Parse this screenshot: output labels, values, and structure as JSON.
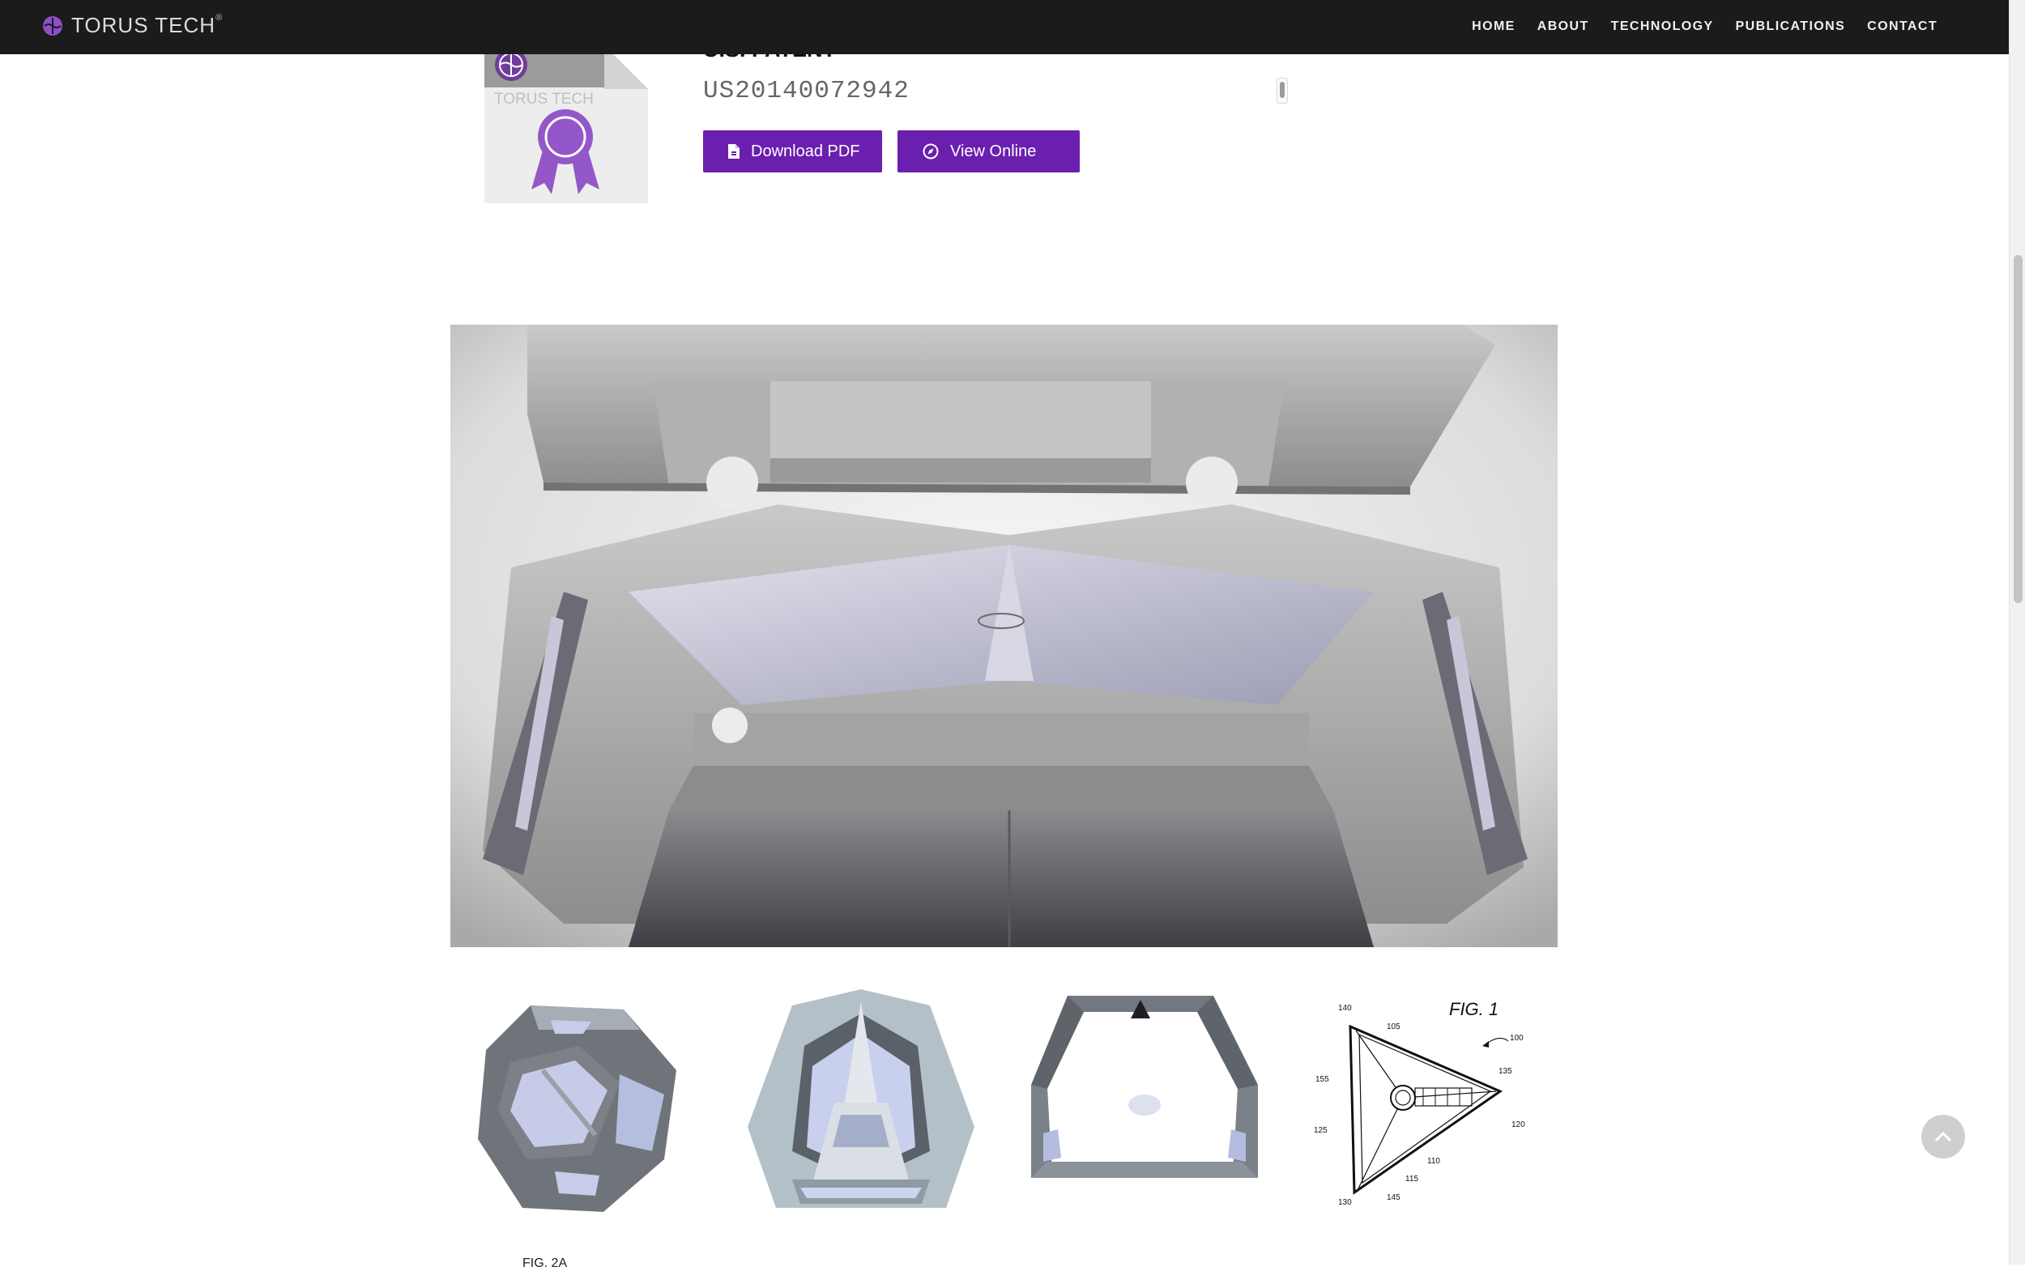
{
  "header": {
    "brand": "TORUS TECH",
    "brand_tm": "®",
    "nav": [
      "HOME",
      "ABOUT",
      "TECHNOLOGY",
      "PUBLICATIONS",
      "CONTACT"
    ]
  },
  "patent": {
    "label": "U.S. PATENT",
    "number": "US20140072942",
    "icon_text": "TORUS TECH",
    "download_label": "Download PDF",
    "view_label": "View Online"
  },
  "figures": {
    "fig1_label": "FIG. 1",
    "refs": [
      "140",
      "105",
      "100",
      "135",
      "155",
      "120",
      "125",
      "110",
      "115",
      "130",
      "145"
    ],
    "caption": "FIG. 2A"
  },
  "colors": {
    "nav_bg": "#1b1b1b",
    "accent": "#6a1fae",
    "brand_purple": "#8e4fc8"
  },
  "icons": {
    "brand": "torus-logo-icon",
    "download": "file-icon",
    "view": "compass-icon",
    "back_to_top": "chevron-up-icon"
  }
}
